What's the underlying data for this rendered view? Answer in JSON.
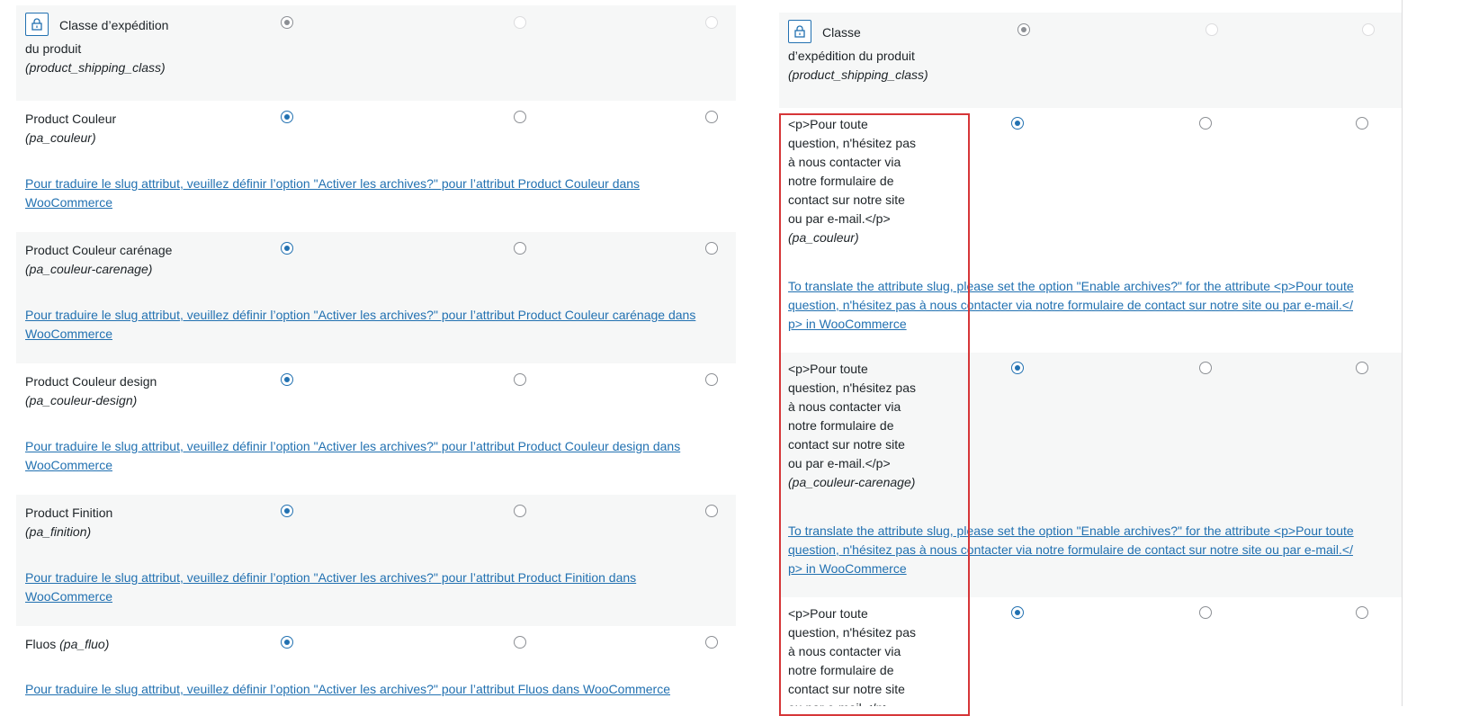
{
  "left": {
    "shipping": {
      "label_line1": "Classe d’expédition",
      "label_line2": "du produit",
      "slug": "(product_shipping_class)"
    },
    "rows": [
      {
        "name": "Product Couleur",
        "slug": "(pa_couleur)",
        "link_line1": "Pour traduire le slug attribut, veuillez définir l’option \"Activer les archives?\" pour l’attribut Product Couleur dans",
        "link_line2": "WooCommerce"
      },
      {
        "name": "Product Couleur carénage",
        "slug": "(pa_couleur-carenage)",
        "link_line1": "Pour traduire le slug attribut, veuillez définir l’option \"Activer les archives?\" pour l’attribut Product Couleur carénage dans",
        "link_line2": "WooCommerce"
      },
      {
        "name": "Product Couleur design",
        "slug": "(pa_couleur-design)",
        "link_line1": "Pour traduire le slug attribut, veuillez définir l’option \"Activer les archives?\" pour l’attribut Product Couleur design dans",
        "link_line2": "WooCommerce"
      },
      {
        "name": "Product Finition",
        "slug": "(pa_finition)",
        "link_line1": "Pour traduire le slug attribut, veuillez définir l’option \"Activer les archives?\" pour l’attribut Product Finition dans",
        "link_line2": "WooCommerce"
      }
    ],
    "fluos": {
      "name": "Fluos",
      "slug": "(pa_fluo)",
      "link": "Pour traduire le slug attribut, veuillez définir l’option \"Activer les archives?\" pour l’attribut Fluos dans WooCommerce"
    }
  },
  "right": {
    "shipping": {
      "label_line1": "Classe",
      "label_line2": "d’expédition du produit",
      "slug": "(product_shipping_class)"
    },
    "desc_lines": [
      "<p>Pour toute",
      "question, n'hésitez pas",
      "à nous contacter via",
      "notre formulaire de",
      "contact sur notre site",
      "ou par e-mail.</p>"
    ],
    "rows": [
      {
        "slug": "(pa_couleur)",
        "link_line1": "To translate the attribute slug, please set the option \"Enable archives?\" for the attribute <p>Pour toute",
        "link_line2": "question, n'hésitez pas à nous contacter via notre formulaire de contact sur notre site ou par e-mail.</",
        "link_line3": "p> in WooCommerce"
      },
      {
        "slug": "(pa_couleur-carenage)",
        "link_line1": "To translate the attribute slug, please set the option \"Enable archives?\" for the attribute <p>Pour toute",
        "link_line2": "question, n'hésitez pas à nous contacter via notre formulaire de contact sur notre site ou par e-mail.</",
        "link_line3": "p> in WooCommerce"
      }
    ]
  }
}
